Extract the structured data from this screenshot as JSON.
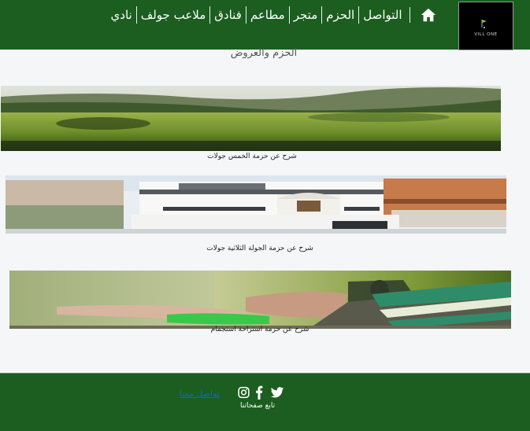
{
  "header": {
    "nav_items": [
      "التواصل",
      "الحزم",
      "متجر",
      "مطاعم",
      "فنادق",
      "ملاعب جولف",
      "نادي"
    ],
    "icons": {
      "home": "home-icon"
    },
    "colors": {
      "bar": "#1b5e20",
      "text": "#ffffff"
    }
  },
  "logo": {
    "text": "VILL  ONE"
  },
  "page_title": "الحزم والعروض",
  "packages": [
    {
      "caption": "شرح عن حزمة الخمس جولات",
      "image": "golf-course-landscape"
    },
    {
      "caption": "شرح عن حزمة الجولة الثلاثية جولات",
      "image": "white-hotel-building"
    },
    {
      "caption": "شرح عن حزمة استراحة استجمام",
      "image": "man-relaxing-lounger"
    }
  ],
  "footer": {
    "contact_link": "تواصل معنا",
    "follow_text": "تابع صفحاتنا",
    "social_icons": [
      "twitter-icon",
      "facebook-icon",
      "instagram-icon"
    ],
    "colors": {
      "background": "#1b5e20",
      "link": "#1565c0"
    }
  }
}
